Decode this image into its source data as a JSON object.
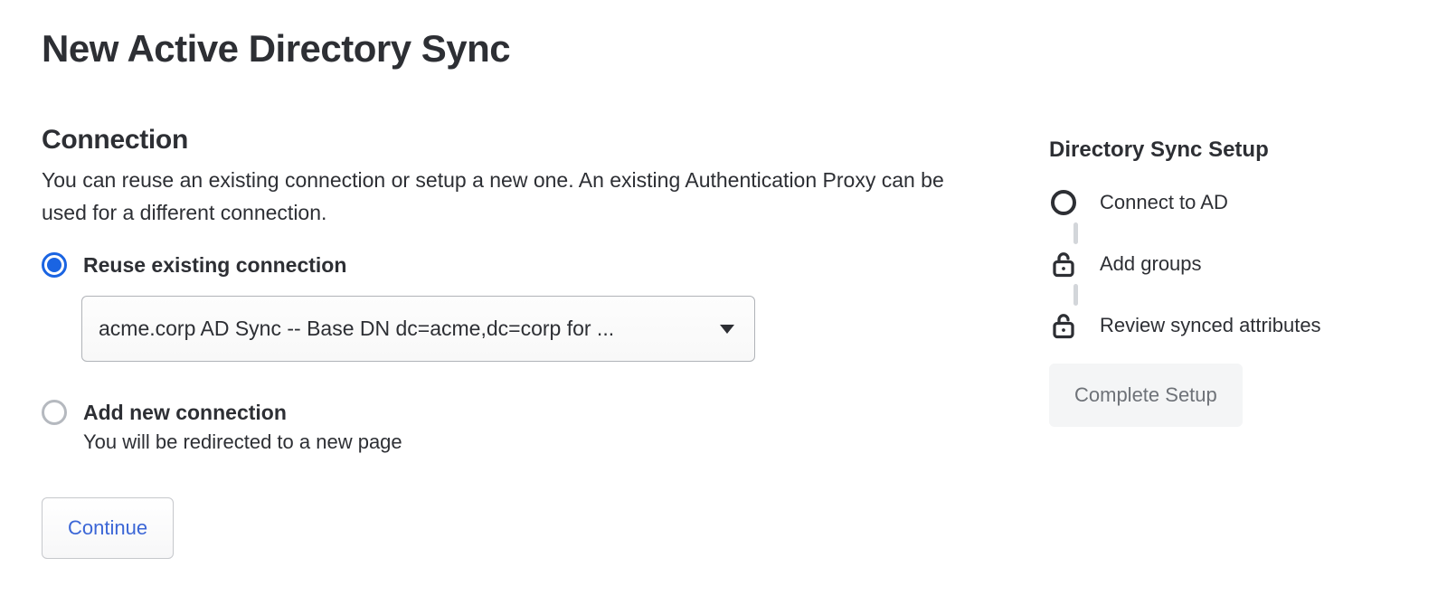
{
  "page": {
    "title": "New Active Directory Sync"
  },
  "connection": {
    "heading": "Connection",
    "description": "You can reuse an existing connection or setup a new one. An existing Authentication Proxy can be used for a different connection.",
    "reuse": {
      "label": "Reuse existing connection",
      "select_value": "acme.corp AD Sync -- Base DN dc=acme,dc=corp for ..."
    },
    "add_new": {
      "label": "Add new connection",
      "sub": "You will be redirected to a new page"
    },
    "continue_label": "Continue"
  },
  "sidebar": {
    "title": "Directory Sync Setup",
    "steps": [
      {
        "label": "Connect to AD",
        "icon": "circle"
      },
      {
        "label": "Add groups",
        "icon": "lock"
      },
      {
        "label": "Review synced attributes",
        "icon": "lock"
      }
    ],
    "complete_label": "Complete Setup"
  }
}
